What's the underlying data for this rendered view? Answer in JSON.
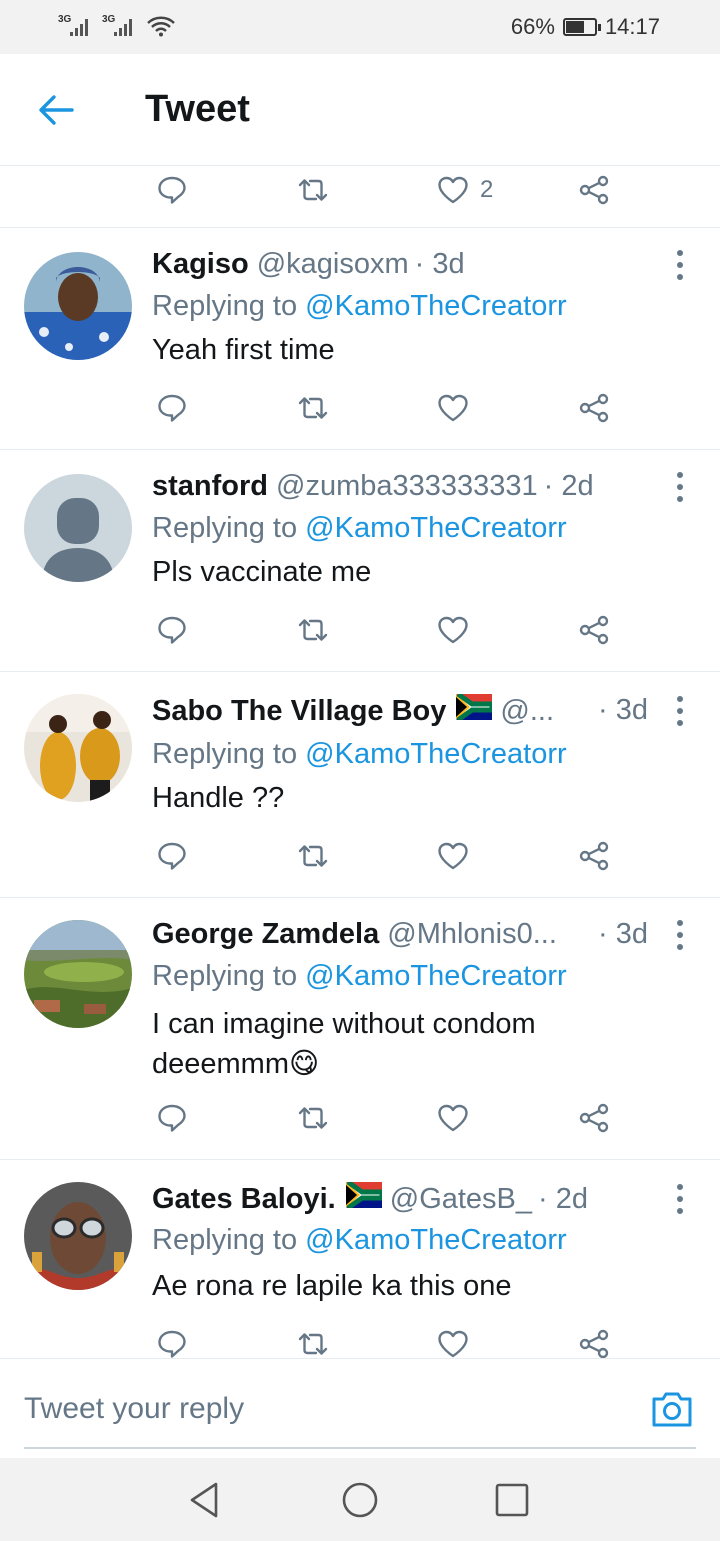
{
  "status_bar": {
    "signal1": "3G",
    "signal2": "3G",
    "battery": "66%",
    "battery_level": 0.66,
    "time": "14:17"
  },
  "header": {
    "title": "Tweet"
  },
  "top_actions": {
    "like_count": "2"
  },
  "tweets": [
    {
      "name": "Kagiso",
      "handle": "@kagisoxm",
      "time": "· 3d",
      "reply_prefix": "Replying to",
      "reply_to": "@KamoTheCreatorr",
      "text": "Yeah first time"
    },
    {
      "name": "stanford",
      "handle": "@zumba333333331",
      "time": "· 2d",
      "reply_prefix": "Replying to",
      "reply_to": "@KamoTheCreatorr",
      "text": "Pls vaccinate me"
    },
    {
      "name": "Sabo The Village Boy",
      "handle": "@...",
      "time": "· 3d",
      "reply_prefix": "Replying to",
      "reply_to": "@KamoTheCreatorr",
      "text": "Handle ??"
    },
    {
      "name": "George Zamdela",
      "handle": "@Mhlonis0...",
      "time": "· 3d",
      "reply_prefix": "Replying to",
      "reply_to": "@KamoTheCreatorr",
      "text": "I can imagine without condom deeemmm😋"
    },
    {
      "name": "Gates Baloyi.",
      "handle": "@GatesB_",
      "time": "· 2d",
      "reply_prefix": "Replying to",
      "reply_to": "@KamoTheCreatorr",
      "text": "Ae rona re lapile ka this one"
    }
  ],
  "reply_bar": {
    "placeholder": "Tweet your reply"
  },
  "colors": {
    "accent": "#1b95e0",
    "muted": "#657786",
    "divider": "#e6ecf0",
    "text": "#14171a"
  },
  "icons": [
    "back-arrow-icon",
    "reply-icon",
    "retweet-icon",
    "like-icon",
    "share-icon",
    "more-vertical-icon",
    "camera-icon",
    "nav-back-icon",
    "nav-home-icon",
    "nav-recents-icon",
    "south-africa-flag"
  ]
}
